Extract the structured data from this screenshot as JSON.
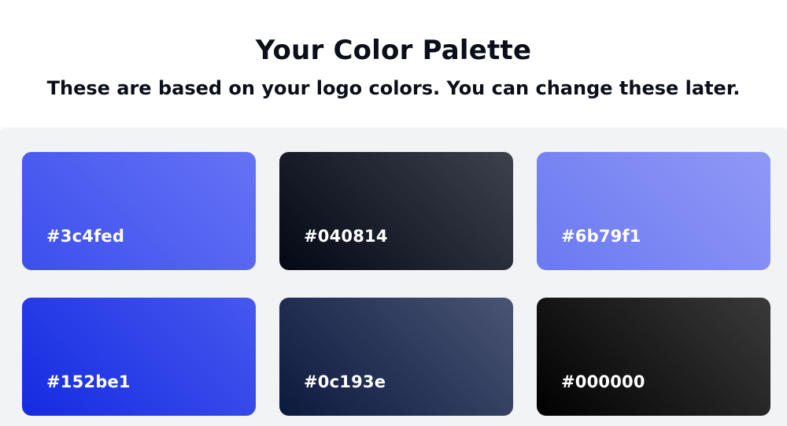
{
  "header": {
    "title": "Your Color Palette",
    "subtitle": "These are based on your logo colors. You can change these later."
  },
  "swatches": [
    {
      "hex": "#3c4fed",
      "gradient_from": "#3c4fed",
      "gradient_to": "#6673f5"
    },
    {
      "hex": "#040814",
      "gradient_from": "#040814",
      "gradient_to": "#3d414d"
    },
    {
      "hex": "#6b79f1",
      "gradient_from": "#6b79f1",
      "gradient_to": "#9099f6"
    },
    {
      "hex": "#152be1",
      "gradient_from": "#152be1",
      "gradient_to": "#4658ee"
    },
    {
      "hex": "#0c193e",
      "gradient_from": "#0c193e",
      "gradient_to": "#4a5574"
    },
    {
      "hex": "#000000",
      "gradient_from": "#000000",
      "gradient_to": "#3a3a3a"
    }
  ]
}
